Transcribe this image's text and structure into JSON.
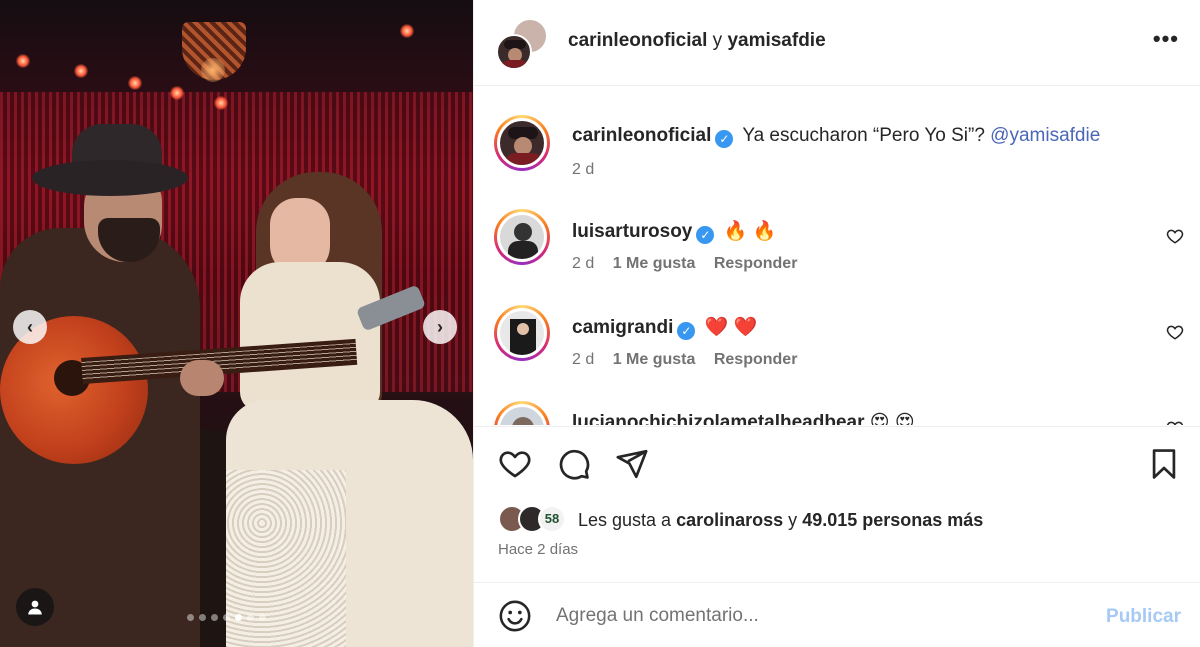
{
  "post": {
    "header": {
      "user1": "carinleonoficial",
      "joiner": "y",
      "user2": "yamisafdie",
      "more_label": "•••"
    },
    "caption": {
      "username": "carinleonoficial",
      "text": "Ya escucharon “Pero Yo Si”?",
      "mention": "@yamisafdie",
      "time": "2 d"
    },
    "comments": [
      {
        "username": "luisarturosoy",
        "text": "🔥 🔥",
        "time": "2 d",
        "likes": "1 Me gusta",
        "reply": "Responder"
      },
      {
        "username": "camigrandi",
        "text": "❤️ ❤️",
        "time": "2 d",
        "likes": "1 Me gusta",
        "reply": "Responder"
      },
      {
        "username": "lucianochichizolametalheadbear",
        "text": "😍 😍"
      }
    ],
    "likes": {
      "prefix": "Les gusta a",
      "user": "carolinaross",
      "joiner": "y",
      "others": "49.015 personas más",
      "badge": "58"
    },
    "timestamp": "Hace 2 días",
    "comment_box": {
      "placeholder": "Agrega un comentario...",
      "publish_label": "Publicar"
    },
    "carousel": {
      "prev": "‹",
      "next": "›",
      "total": 7,
      "active_index": 4
    }
  },
  "colors": {
    "link": "#4a67b8",
    "verified": "#3897f0",
    "publish_disabled": "#a6c9f5",
    "muted": "#737373"
  }
}
